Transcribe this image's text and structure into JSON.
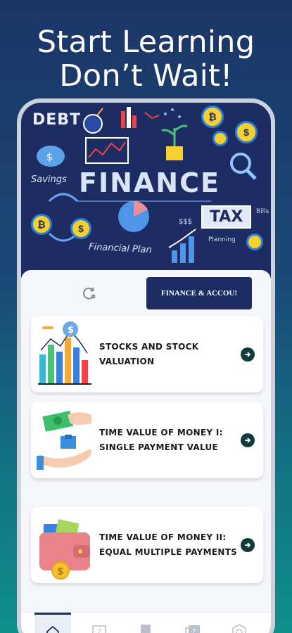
{
  "headline": {
    "line1": "Start Learning",
    "line2": "Don’t Wait!"
  },
  "hero_image": {
    "words": {
      "debt": "DEBT",
      "finance": "FINANCE",
      "savings": "Savings",
      "financial_plan": "Financial Plan",
      "tax": "TAX",
      "planning": "Planning",
      "bills": "Bills",
      "dollars": "$$$"
    }
  },
  "toolbar": {
    "category_label": "FINANCE & ACCOU!"
  },
  "topics": [
    {
      "title": "STOCKS AND STOCK VALUATION",
      "icon": "stock-chart-illustration"
    },
    {
      "title": "TIME VALUE OF MONEY I: SINGLE PAYMENT VALUE",
      "icon": "hands-money-illustration"
    },
    {
      "title": "TIME VALUE OF MONEY II: EQUAL MULTIPLE PAYMENTS",
      "icon": "wallet-illustration"
    }
  ],
  "bottom_nav": [
    {
      "name": "home",
      "icon": "home-icon",
      "active": true
    },
    {
      "name": "quiz",
      "icon": "question-bubble-icon",
      "active": false
    },
    {
      "name": "bookmarks",
      "icon": "bookmark-icon",
      "active": false
    },
    {
      "name": "questions",
      "icon": "question-cards-icon",
      "active": false
    },
    {
      "name": "settings",
      "icon": "settings-icon",
      "active": false
    }
  ],
  "colors": {
    "navy": "#1d2c63",
    "arrow": "#0f3b3b",
    "gradient_top": "#1b3566",
    "gradient_bottom": "#0e8f8a"
  }
}
